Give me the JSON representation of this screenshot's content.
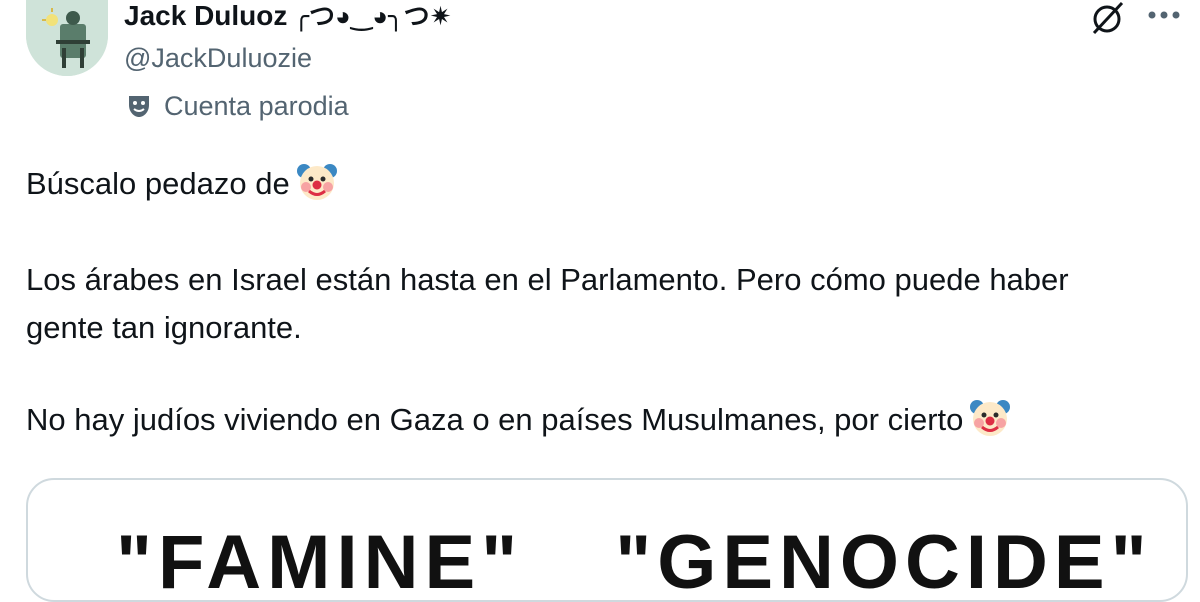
{
  "author": {
    "name": "Jack Duluoz",
    "name_emoticon": "╭つ◕‿◕╮つ✷",
    "handle": "@JackDuluozie",
    "parody_label": "Cuenta parodia",
    "avatar_icon": "avatar-image"
  },
  "actions": {
    "grok_icon": "grok-icon",
    "more_icon": "more-dots-icon"
  },
  "tweet": {
    "line1": "Búscalo pedazo de",
    "line2": "Los árabes en Israel están  hasta en el Parlamento. Pero cómo puede haber gente tan ignorante.",
    "line3": "No hay judíos viviendo en Gaza o en países Musulmanes, por cierto",
    "emoji_icon": "clown-face-icon"
  },
  "media": {
    "word1": "\"FAMINE\"",
    "word2": "\"GENOCIDE\""
  },
  "colors": {
    "text": "#0f1419",
    "secondary": "#536471",
    "border": "#cfd9de",
    "avatar_bg": "#cfe3d9"
  }
}
